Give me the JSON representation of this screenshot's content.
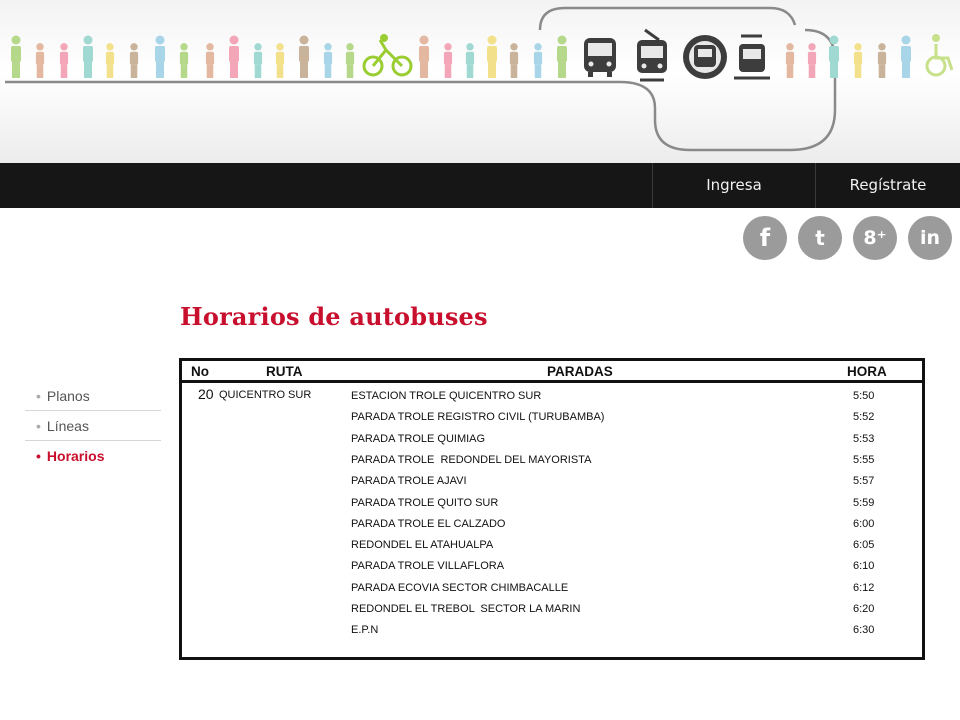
{
  "nav": {
    "login_label": "Ingresa",
    "register_label": "Regístrate"
  },
  "social": [
    {
      "icon": "facebook-icon",
      "glyph": "f"
    },
    {
      "icon": "twitter-icon",
      "glyph": "t"
    },
    {
      "icon": "google-plus-icon",
      "glyph": "8⁺"
    },
    {
      "icon": "linkedin-icon",
      "glyph": "in"
    }
  ],
  "sidebar": {
    "items": [
      {
        "label": "Planos",
        "active": false
      },
      {
        "label": "Líneas",
        "active": false
      },
      {
        "label": "Horarios",
        "active": true
      }
    ]
  },
  "page": {
    "title": "Horarios de autobuses"
  },
  "schedule": {
    "headers": {
      "no": "No",
      "route": "RUTA",
      "stops": "PARADAS",
      "time": "HORA"
    },
    "route_no": "20",
    "route_name": "QUICENTRO SUR",
    "stops": [
      {
        "name": "ESTACION TROLE QUICENTRO SUR",
        "time": "5:50"
      },
      {
        "name": "PARADA TROLE REGISTRO CIVIL (TURUBAMBA)",
        "time": "5:52"
      },
      {
        "name": "PARADA TROLE QUIMIAG",
        "time": "5:53"
      },
      {
        "name": "PARADA TROLE  REDONDEL DEL MAYORISTA",
        "time": "5:55"
      },
      {
        "name": "PARADA TROLE AJAVI",
        "time": "5:57"
      },
      {
        "name": "PARADA TROLE QUITO SUR",
        "time": "5:59"
      },
      {
        "name": "PARADA TROLE EL CALZADO",
        "time": "6:00"
      },
      {
        "name": "REDONDEL EL ATAHUALPA",
        "time": "6:05"
      },
      {
        "name": "PARADA TROLE VILLAFLORA",
        "time": "6:10"
      },
      {
        "name": "PARADA ECOVIA SECTOR CHIMBACALLE",
        "time": "6:12"
      },
      {
        "name": "REDONDEL EL TREBOL  SECTOR LA MARIN",
        "time": "6:20"
      },
      {
        "name": "E.P.N",
        "time": "6:30"
      }
    ]
  },
  "colors": {
    "accent": "#c8102e",
    "topbar": "#161616",
    "social": "#9b9b9b"
  }
}
